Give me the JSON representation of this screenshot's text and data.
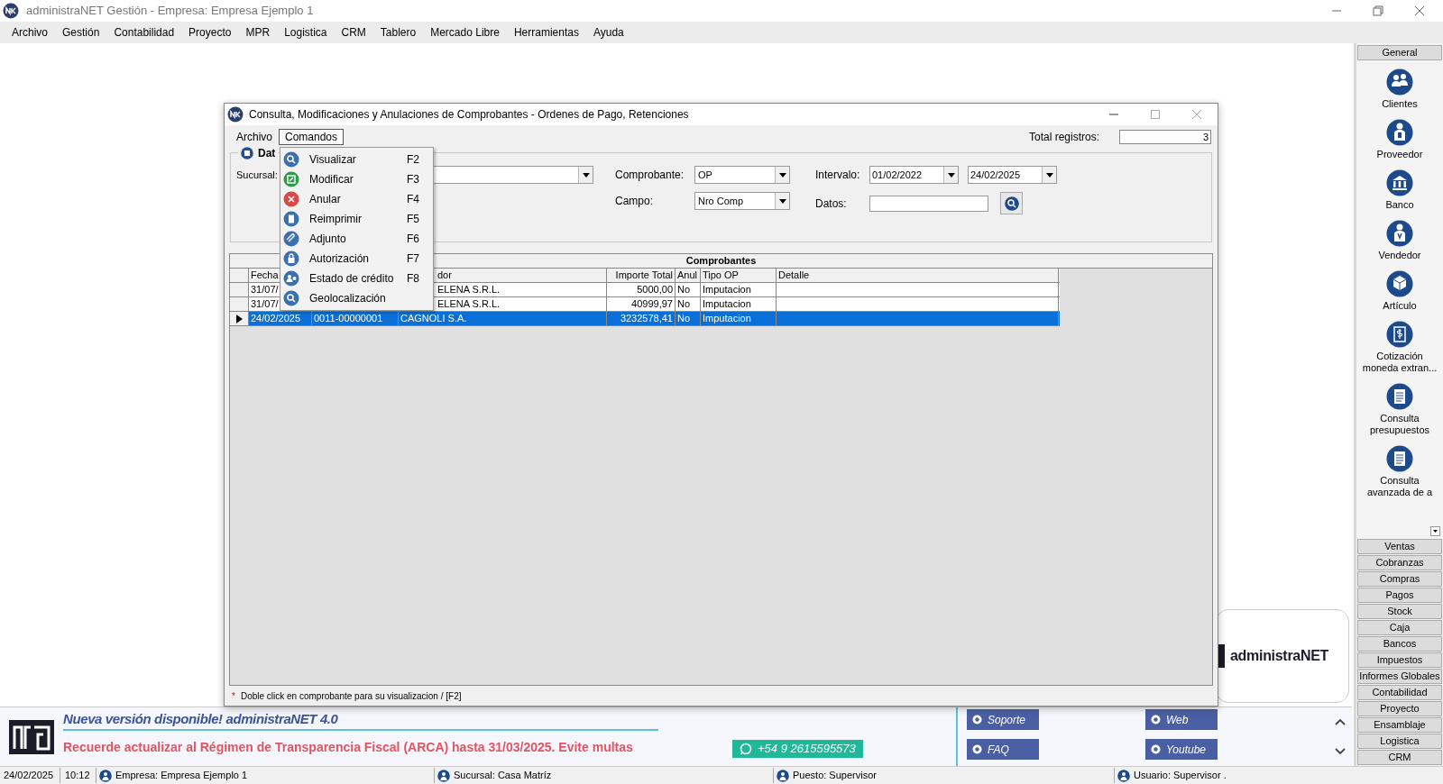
{
  "window": {
    "title": "administraNET Gestión - Empresa: Empresa Ejemplo 1"
  },
  "menu_bar": [
    "Archivo",
    "Gestión",
    "Contabilidad",
    "Proyecto",
    "MPR",
    "Logistica",
    "CRM",
    "Tablero",
    "Mercado Libre",
    "Herramientas",
    "Ayuda"
  ],
  "dialog": {
    "title": "Consulta, Modificaciones y Anulaciones de Comprobantes - Ordenes de Pago, Retenciones",
    "menu": [
      {
        "label": "Archivo",
        "selected": false
      },
      {
        "label": "Comandos",
        "selected": true
      }
    ],
    "total_registros": {
      "label": "Total registros:",
      "value": "3"
    },
    "group_label": "Dat",
    "filters": {
      "sucursal": {
        "label": "Sucursal:"
      },
      "comprobante": {
        "label": "Comprobante:",
        "value": "OP"
      },
      "campo": {
        "label": "Campo:",
        "value": "Nro Comp"
      },
      "intervalo": {
        "label": "Intervalo:",
        "from": "01/02/2022",
        "to": "24/02/2025"
      },
      "datos": {
        "label": "Datos:"
      }
    },
    "table": {
      "title": "Comprobantes",
      "columns": [
        "Fecha",
        null,
        "dor",
        "Importe Total",
        "Anul",
        "Tipo OP",
        "Detalle"
      ],
      "rows": [
        {
          "selected": false,
          "cells": [
            "31/07/",
            null,
            "ELENA S.R.L.",
            "5000,00",
            "No",
            "Imputacion"
          ]
        },
        {
          "selected": false,
          "cells": [
            "31/07/",
            null,
            "ELENA S.R.L.",
            "40999,97",
            "No",
            "Imputacion"
          ]
        },
        {
          "selected": true,
          "cells": [
            "24/02/2025",
            "0011-00000001",
            "CAGNOLI S.A.",
            "3232578,41",
            "No",
            "Imputacion"
          ]
        }
      ]
    },
    "footer_note": {
      "mark": "*",
      "text": "Doble click en comprobante para su visualizacion / [F2]"
    },
    "commands_menu": [
      {
        "label": "Visualizar",
        "shortcut": "F2"
      },
      {
        "label": "Modificar",
        "shortcut": "F3"
      },
      {
        "label": "Anular",
        "shortcut": "F4"
      },
      {
        "label": "Reimprimir",
        "shortcut": "F5"
      },
      {
        "label": "Adjunto",
        "shortcut": "F6"
      },
      {
        "label": "Autorización",
        "shortcut": "F7"
      },
      {
        "label": "Estado de crédito",
        "shortcut": "F8"
      },
      {
        "label": "Geolocalización"
      }
    ]
  },
  "logo_card": {
    "text": "administraNET"
  },
  "news": {
    "headline": "Nueva versión disponible! administraNET 4.0",
    "notice": "Recuerde actualizar al Régimen de Transparencia Fiscal (ARCA) hasta 31/03/2025. Evite multas",
    "whatsapp": "+54 9 2615595573"
  },
  "links": [
    "Soporte",
    "Web",
    "FAQ",
    "Youtube"
  ],
  "sidebar": {
    "open_section": {
      "label": "General",
      "items": [
        "Clientes",
        "Proveedor",
        "Banco",
        "Vendedor",
        "Artículo",
        "Cotización moneda extran...",
        "Consulta presupuestos",
        "Consulta avanzada de a"
      ]
    },
    "other_sections": [
      "Ventas",
      "Cobranzas",
      "Compras",
      "Pagos",
      "Stock",
      "Caja",
      "Bancos",
      "Impuestos",
      "Informes Globales",
      "Contabilidad",
      "Proyecto",
      "Ensamblaje",
      "Logistica",
      "CRM"
    ]
  },
  "status_bar": {
    "date": "24/02/2025",
    "time": "10:12",
    "empresa": "Empresa: Empresa Ejemplo 1",
    "sucursal": "Sucursal: Casa Matríz",
    "puesto": "Puesto: Supervisor",
    "usuario": "Usuario: Supervisor ."
  }
}
